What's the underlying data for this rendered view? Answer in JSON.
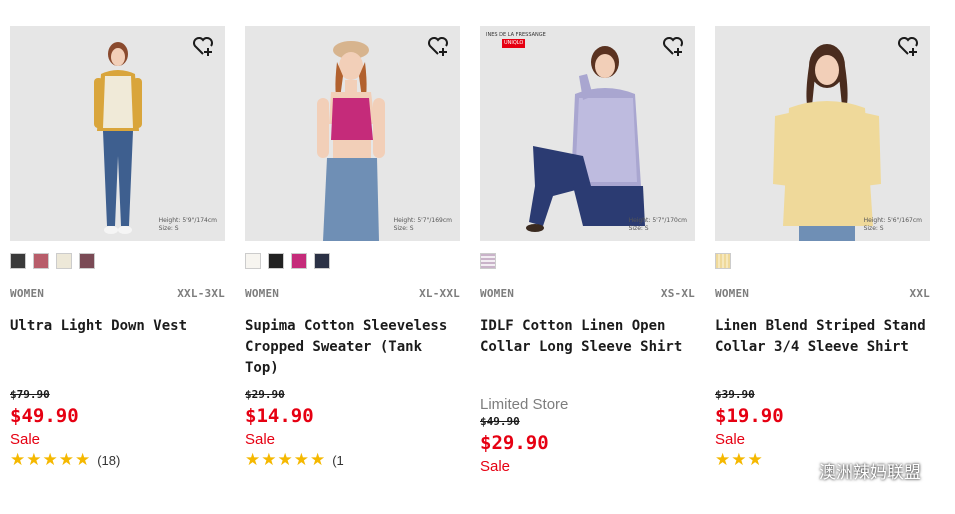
{
  "products": [
    {
      "gender": "WOMEN",
      "sizes": "XXL-3XL",
      "name_line1": "Ultra Light Down Vest",
      "name_line2": "",
      "limited": "",
      "old_price": "$79.90",
      "price": "$49.90",
      "sale": "Sale",
      "rating_count": "(18)",
      "stars": "★★★★★",
      "size_note_1": "Height: 5'9\"/174cm",
      "size_note_2": "Size: S",
      "brand_note": "",
      "swatches": [
        "#3a3a3a",
        "#b85d6a",
        "#ede8d8",
        "#7a4a55"
      ],
      "image_bg": "#e6e6e6"
    },
    {
      "gender": "WOMEN",
      "sizes": "XL-XXL",
      "name_line1": "Supima Cotton Sleeveless",
      "name_line2": "Cropped Sweater (Tank Top)",
      "limited": "",
      "old_price": "$29.90",
      "price": "$14.90",
      "sale": "Sale",
      "rating_count": "(1",
      "stars": "★★★★★",
      "size_note_1": "Height: 5'7\"/169cm",
      "size_note_2": "Size: S",
      "brand_note": "",
      "swatches": [
        "#f7f5f0",
        "#222222",
        "#c52b7a",
        "#2b3145"
      ],
      "image_bg": "#e6e6e6"
    },
    {
      "gender": "WOMEN",
      "sizes": "XS-XL",
      "name_line1": "IDLF Cotton Linen Open",
      "name_line2": "Collar Long Sleeve Shirt",
      "limited": "Limited Store",
      "old_price": "$49.90",
      "price": "$29.90",
      "sale": "Sale",
      "rating_count": "",
      "stars": "",
      "size_note_1": "Height: 5'7\"/170cm",
      "size_note_2": "Size: S",
      "brand_note": "INES DE LA FRESSANGE",
      "brand_logo": "UNIQLO",
      "swatches": [
        "#c9b3c9"
      ],
      "image_bg": "#e6e6e6"
    },
    {
      "gender": "WOMEN",
      "sizes": "XXL",
      "name_line1": "Linen Blend Striped Stand",
      "name_line2": "Collar 3/4 Sleeve Shirt",
      "limited": "",
      "old_price": "$39.90",
      "price": "$19.90",
      "sale": "Sale",
      "rating_count": "",
      "stars": "★★★",
      "size_note_1": "Height: 5'6\"/167cm",
      "size_note_2": "Size: S",
      "brand_note": "",
      "swatches": [
        "#efd99a"
      ],
      "image_bg": "#e6e6e6"
    }
  ],
  "watermark": "澳洲辣妈联盟",
  "colors": {
    "sale_red": "#e60012",
    "star": "#f5b800",
    "meta_gray": "#7d7d7d"
  }
}
